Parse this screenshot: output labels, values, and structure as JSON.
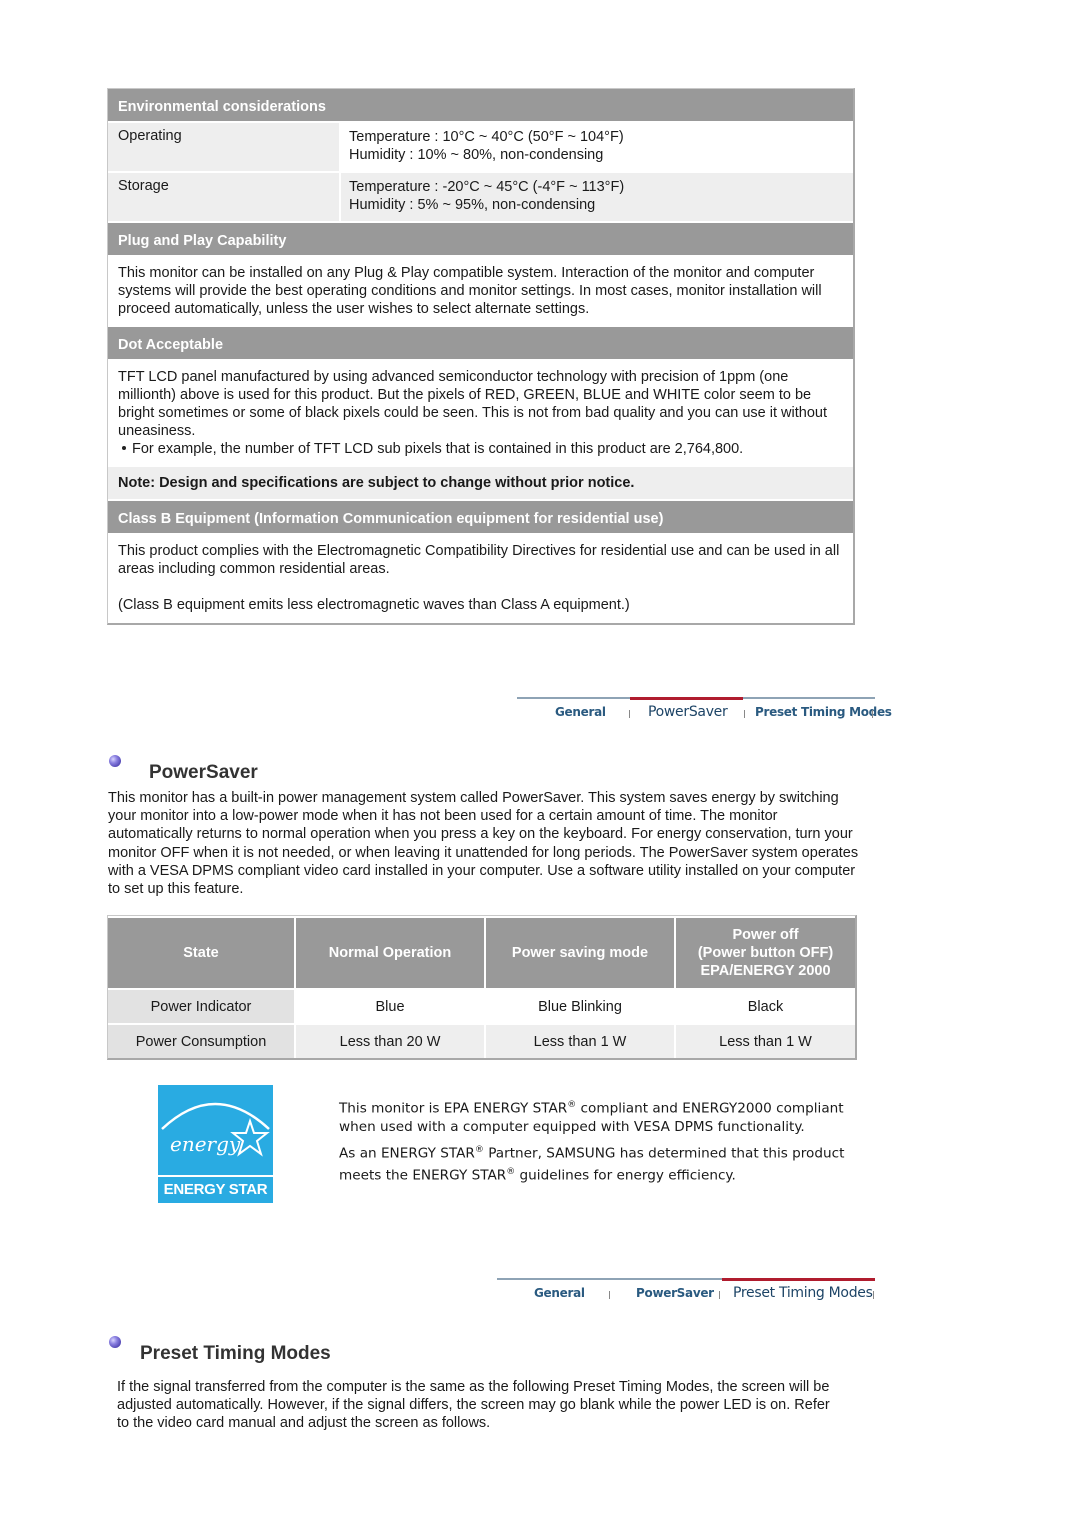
{
  "spec_table": {
    "environmental": {
      "heading": "Environmental considerations",
      "rows": [
        {
          "label": "Operating",
          "lines": [
            "Temperature : 10°C ~ 40°C (50°F ~ 104°F)",
            "Humidity : 10% ~ 80%, non-condensing"
          ]
        },
        {
          "label": "Storage",
          "lines": [
            "Temperature : -20°C ~ 45°C (-4°F ~ 113°F)",
            "Humidity : 5% ~ 95%, non-condensing"
          ]
        }
      ]
    },
    "plug_and_play": {
      "heading": "Plug and Play Capability",
      "text": "This monitor can be installed on any Plug & Play compatible system. Interaction of the monitor and computer systems will provide the best operating conditions and monitor settings. In most cases, monitor installation will proceed automatically, unless the user wishes to select alternate settings."
    },
    "dot_acceptable": {
      "heading": "Dot Acceptable",
      "text": "TFT LCD panel manufactured by using advanced semiconductor technology with precision of 1ppm (one millionth) above is used for this product. But the pixels of RED, GREEN, BLUE and WHITE color seem to be bright sometimes or some of black pixels could be seen. This is not from bad quality and you can use it without uneasiness.",
      "bullet": "For example, the number of TFT LCD sub pixels that is contained in this product are 2,764,800."
    },
    "note": "Note: Design and specifications are subject to change without prior notice.",
    "class_b": {
      "heading": "Class B Equipment (Information Communication equipment for residential use)",
      "text1": "This product complies with the Electromagnetic Compatibility Directives for residential use and can be used in all areas including common residential areas.",
      "text2": "(Class B equipment emits less electromagnetic waves than Class A equipment.)"
    }
  },
  "nav1": {
    "tabs": [
      {
        "label": "General",
        "active": false
      },
      {
        "label": "PowerSaver",
        "active": true
      },
      {
        "label": "Preset Timing Modes",
        "active": false
      }
    ]
  },
  "powersaver": {
    "title": "PowerSaver",
    "icon": "bullet-orb-icon",
    "text": "This monitor has a built-in power management system called PowerSaver. This system saves energy by switching your monitor into a low-power mode when it has not been used for a certain amount of time. The monitor automatically returns to normal operation when you press a key on the keyboard. For energy conservation, turn your monitor OFF when it is not needed, or when leaving it unattended for long periods. The PowerSaver system operates with a VESA DPMS compliant video card installed in your computer. Use a software utility installed on your computer to set up this feature.",
    "table": {
      "headers": [
        "State",
        "Normal Operation",
        "Power saving mode",
        "Power off",
        "(Power button OFF)",
        "EPA/ENERGY 2000"
      ],
      "rows": [
        {
          "label": "Power Indicator",
          "values": [
            "Blue",
            "Blue Blinking",
            "Black"
          ]
        },
        {
          "label": "Power Consumption",
          "values": [
            "Less than 20 W",
            "Less than 1 W",
            "Less than 1 W"
          ]
        }
      ]
    }
  },
  "energy_star": {
    "logo_script": "energy",
    "logo_band": "ENERGY STAR",
    "p1_a": "This monitor is EPA ENERGY STAR",
    "reg": "®",
    "p1_b": " compliant and ENERGY2000 compliant when used with a computer equipped with VESA DPMS functionality.",
    "p2_a": "As an ENERGY STAR",
    "p2_b": " Partner, SAMSUNG has determined that this product meets the ENERGY STAR",
    "p2_c": " guidelines for energy efficiency."
  },
  "nav2": {
    "tabs": [
      {
        "label": "General",
        "active": false
      },
      {
        "label": "PowerSaver",
        "active": false
      },
      {
        "label": "Preset Timing Modes",
        "active": true
      }
    ]
  },
  "preset": {
    "title": "Preset Timing Modes",
    "icon": "bullet-orb-icon",
    "text": "If the signal transferred from the computer is the same as the following Preset Timing Modes, the screen will be adjusted automatically. However, if the signal differs, the screen may go blank while the power LED is on. Refer to the video card manual and adjust the screen as follows."
  }
}
